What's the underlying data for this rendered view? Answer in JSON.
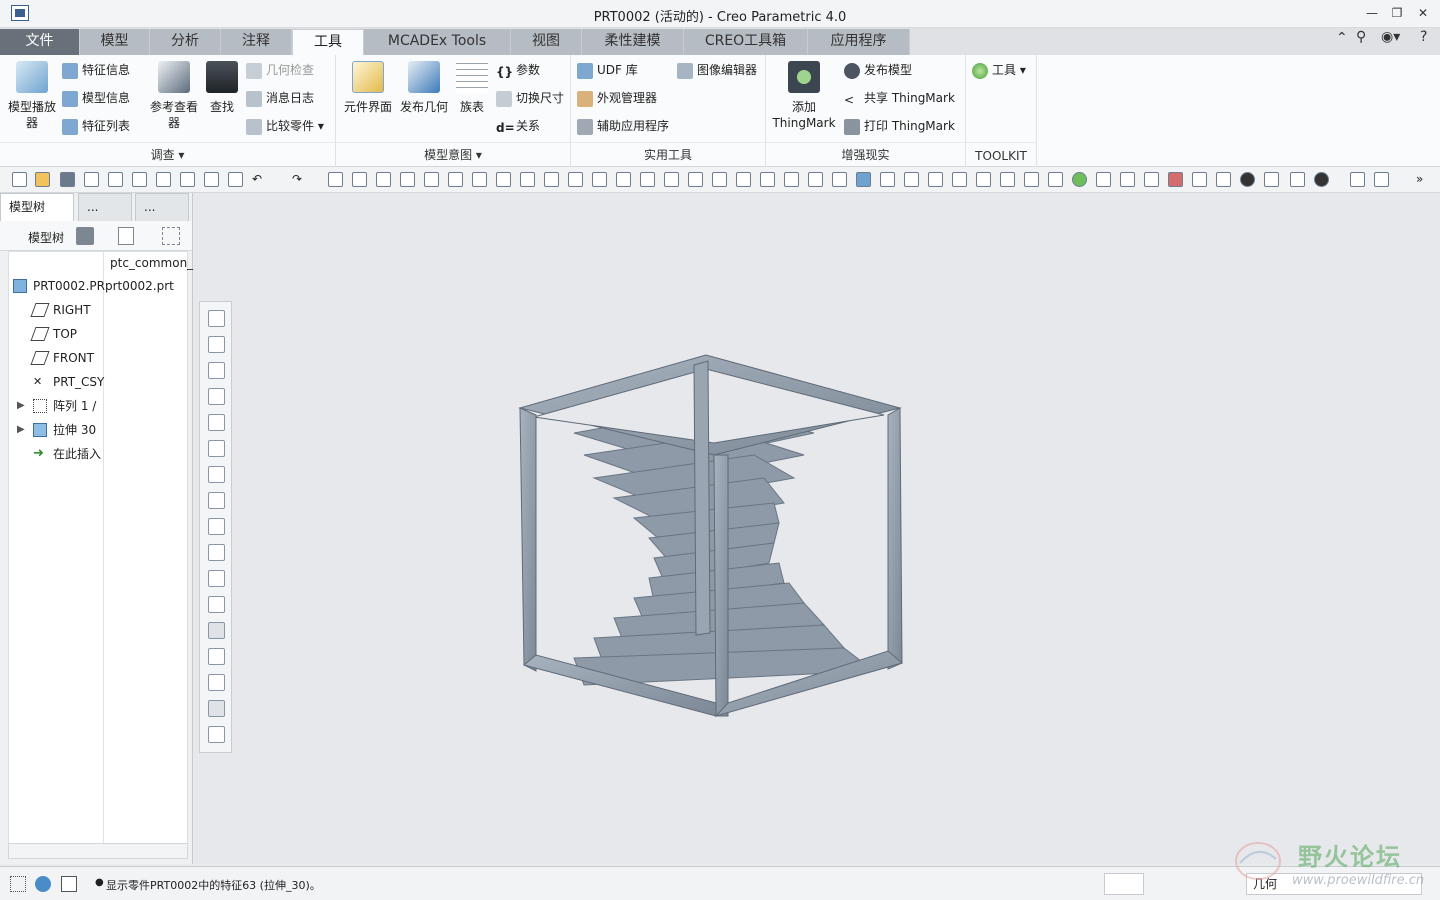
{
  "window": {
    "title": "PRT0002 (活动的) - Creo Parametric 4.0",
    "controls": [
      "minimize",
      "restore",
      "close"
    ]
  },
  "tabs": [
    {
      "label": "文件"
    },
    {
      "label": "模型"
    },
    {
      "label": "分析"
    },
    {
      "label": "注释"
    },
    {
      "label": "工具",
      "active": true
    },
    {
      "label": "MCADEx Tools"
    },
    {
      "label": "视图"
    },
    {
      "label": "柔性建模"
    },
    {
      "label": "CREO工具箱"
    },
    {
      "label": "应用程序"
    }
  ],
  "ribbon": {
    "investigate": {
      "label": "调查",
      "model_player": "模型播放\n器",
      "feature_info": "特征信息",
      "model_info": "模型信息",
      "feature_list": "特征列表",
      "reference_viewer": "参考查看\n器",
      "find": "查找",
      "geometry_check": "几何检查",
      "message_log": "消息日志",
      "compare_part": "比较零件"
    },
    "model_intent": {
      "label": "模型意图",
      "component_interface": "元件界面",
      "publish_geometry": "发布几何",
      "family_table": "族表",
      "parameters": "参数",
      "switch_dimensions": "切换尺寸",
      "relations": "关系"
    },
    "utilities": {
      "label": "实用工具",
      "udf_library": "UDF 库",
      "image_editor": "图像编辑器",
      "appearance_manager": "外观管理器",
      "auxiliary_apps": "辅助应用程序"
    },
    "augmented_reality": {
      "label": "增强现实",
      "add_thingmark": "添加\nThingMark",
      "publish_model": "发布模型",
      "share_thingmark": "共享 ThingMark",
      "print_thingmark": "打印 ThingMark"
    },
    "toolkit": {
      "label": "TOOLKIT",
      "tools": "工具"
    }
  },
  "left_panel": {
    "tabs": [
      "模型树",
      "...",
      "..."
    ],
    "tree_label": "模型树",
    "column_header": "ptc_common_",
    "tree_items": [
      {
        "label": "PRT0002.PR",
        "value": "prt0002.prt",
        "icon": "part-icon"
      },
      {
        "label": "RIGHT",
        "icon": "datum-plane-icon"
      },
      {
        "label": "TOP",
        "icon": "datum-plane-icon"
      },
      {
        "label": "FRONT",
        "icon": "datum-plane-icon"
      },
      {
        "label": "PRT_CSY",
        "icon": "coordinate-system-icon"
      },
      {
        "label": "阵列 1 /",
        "icon": "pattern-icon",
        "expandable": true
      },
      {
        "label": "拉伸 30",
        "icon": "extrude-icon",
        "expandable": true
      },
      {
        "label": "在此插入",
        "icon": "insert-here-arrow-icon"
      }
    ]
  },
  "status": {
    "message": "显示零件PRT0002中的特征63 (拉伸_30)。",
    "filter_value": "几何"
  },
  "watermark": {
    "title": "野火论坛",
    "url": "www.proewildfire.cn"
  },
  "colors": {
    "active_tab": "#fafbfc",
    "file_tab": "#68707a",
    "tab_inactive": "#b6bcc3",
    "viewport_bg": "#e6e8eb",
    "model_fill": "#8e9aa8"
  }
}
